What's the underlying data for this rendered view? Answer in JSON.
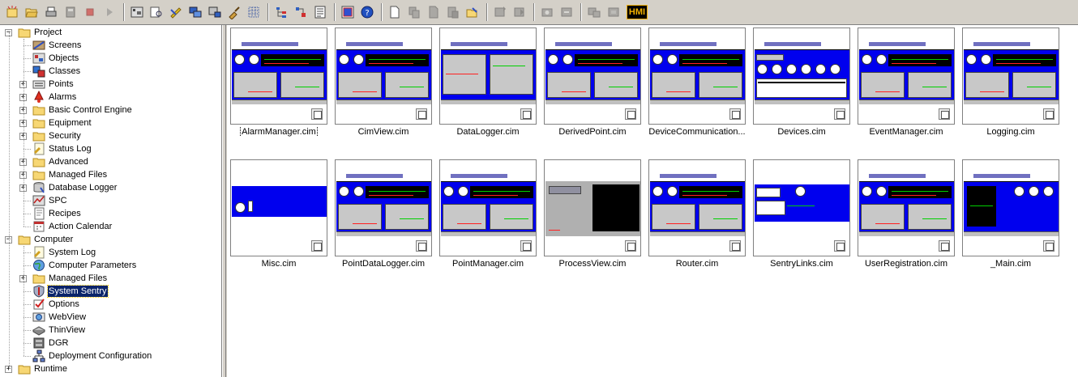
{
  "toolbar": {
    "icons": [
      "new-project-icon",
      "open-icon",
      "print-icon",
      "refresh-icon",
      "stop-icon",
      "run-icon",
      "screen-editor-icon",
      "find-icon",
      "tools-icon",
      "windows-icon",
      "deploy-icon",
      "broom-icon",
      "grid-icon",
      "tree-icon",
      "filter-icon",
      "details-view-icon",
      "thumbnail-view-icon",
      "help-icon",
      "new-icon",
      "copy-icon",
      "page-icon",
      "paste-icon",
      "edit-icon",
      "import-icon",
      "export-icon",
      "camera-icon",
      "publish-icon",
      "camera-copy-icon",
      "camera-paste-icon"
    ],
    "hmi_label": "HMI"
  },
  "tree": {
    "project": {
      "label": "Project",
      "items": [
        {
          "label": "Screens",
          "icon": "screens-icon"
        },
        {
          "label": "Objects",
          "icon": "objects-icon"
        },
        {
          "label": "Classes",
          "icon": "classes-icon"
        },
        {
          "label": "Points",
          "icon": "points-icon"
        },
        {
          "label": "Alarms",
          "icon": "alarms-icon"
        },
        {
          "label": "Basic Control Engine",
          "icon": "folder-icon"
        },
        {
          "label": "Equipment",
          "icon": "folder-icon"
        },
        {
          "label": "Security",
          "icon": "folder-icon"
        },
        {
          "label": "Status Log",
          "icon": "status-log-icon"
        },
        {
          "label": "Advanced",
          "icon": "folder-icon"
        },
        {
          "label": "Managed Files",
          "icon": "folder-icon"
        },
        {
          "label": "Database Logger",
          "icon": "database-logger-icon"
        },
        {
          "label": "SPC",
          "icon": "spc-icon"
        },
        {
          "label": "Recipes",
          "icon": "recipes-icon"
        },
        {
          "label": "Action Calendar",
          "icon": "calendar-icon"
        }
      ]
    },
    "computer": {
      "label": "Computer",
      "items": [
        {
          "label": "System Log",
          "icon": "system-log-icon"
        },
        {
          "label": "Computer Parameters",
          "icon": "globe-icon"
        },
        {
          "label": "Managed Files",
          "icon": "folder-icon"
        },
        {
          "label": "System Sentry",
          "icon": "shield-icon",
          "selected": true
        },
        {
          "label": "Options",
          "icon": "checkmark-icon"
        },
        {
          "label": "WebView",
          "icon": "webview-icon"
        },
        {
          "label": "ThinView",
          "icon": "thinview-icon"
        },
        {
          "label": "DGR",
          "icon": "dgr-icon"
        },
        {
          "label": "Deployment Configuration",
          "icon": "network-icon"
        }
      ]
    },
    "runtime": {
      "label": "Runtime"
    }
  },
  "screens": [
    {
      "name": "AlarmManager.cim",
      "style": "gauges",
      "focused": true
    },
    {
      "name": "CimView.cim",
      "style": "gauges"
    },
    {
      "name": "DataLogger.cim",
      "style": "logger"
    },
    {
      "name": "DerivedPoint.cim",
      "style": "gauges"
    },
    {
      "name": "DeviceCommunication...",
      "style": "gauges"
    },
    {
      "name": "Devices.cim",
      "style": "devices"
    },
    {
      "name": "EventManager.cim",
      "style": "gauges"
    },
    {
      "name": "Logging.cim",
      "style": "gauges"
    },
    {
      "name": "Misc.cim",
      "style": "misc"
    },
    {
      "name": "PointDataLogger.cim",
      "style": "gauges"
    },
    {
      "name": "PointManager.cim",
      "style": "gauges"
    },
    {
      "name": "ProcessView.cim",
      "style": "process"
    },
    {
      "name": "Router.cim",
      "style": "gauges"
    },
    {
      "name": "SentryLinks.cim",
      "style": "links"
    },
    {
      "name": "UserRegistration.cim",
      "style": "gauges"
    },
    {
      "name": "_Main.cim",
      "style": "main"
    }
  ]
}
